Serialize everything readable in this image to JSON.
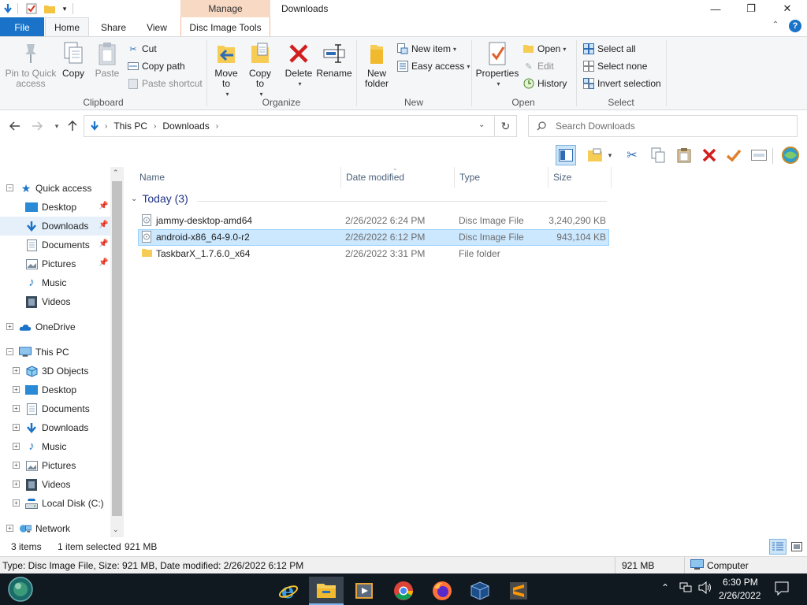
{
  "window": {
    "title": "Downloads",
    "context_tab_group": "Manage",
    "minimize": "—",
    "maximize": "❐",
    "close": "✕"
  },
  "ribbon_tabs": [
    {
      "label": "File"
    },
    {
      "label": "Home"
    },
    {
      "label": "Share"
    },
    {
      "label": "View"
    },
    {
      "label": "Disc Image Tools"
    }
  ],
  "ribbon": {
    "clipboard": {
      "label": "Clipboard",
      "pin": "Pin to Quick access",
      "copy": "Copy",
      "paste": "Paste",
      "cut": "Cut",
      "copy_path": "Copy path",
      "paste_shortcut": "Paste shortcut"
    },
    "organize": {
      "label": "Organize",
      "move_to": "Move to",
      "copy_to": "Copy to",
      "delete": "Delete",
      "rename": "Rename"
    },
    "new": {
      "label": "New",
      "new_folder": "New folder",
      "new_item": "New item",
      "easy_access": "Easy access"
    },
    "open": {
      "label": "Open",
      "properties": "Properties",
      "open": "Open",
      "edit": "Edit",
      "history": "History"
    },
    "select": {
      "label": "Select",
      "select_all": "Select all",
      "select_none": "Select none",
      "invert": "Invert selection"
    }
  },
  "address": {
    "crumbs": [
      "This PC",
      "Downloads"
    ],
    "search_placeholder": "Search Downloads"
  },
  "nav_pane": {
    "quick_access": "Quick access",
    "quick_items": [
      "Desktop",
      "Downloads",
      "Documents",
      "Pictures",
      "Music",
      "Videos"
    ],
    "onedrive": "OneDrive",
    "this_pc": "This PC",
    "pc_items": [
      "3D Objects",
      "Desktop",
      "Documents",
      "Downloads",
      "Music",
      "Pictures",
      "Videos",
      "Local Disk (C:)"
    ],
    "network": "Network"
  },
  "file_list": {
    "columns": [
      "Name",
      "Date modified",
      "Type",
      "Size"
    ],
    "group": "Today (3)",
    "rows": [
      {
        "name": "jammy-desktop-amd64",
        "date": "2/26/2022 6:24 PM",
        "type": "Disc Image File",
        "size": "3,240,290 KB"
      },
      {
        "name": "android-x86_64-9.0-r2",
        "date": "2/26/2022 6:12 PM",
        "type": "Disc Image File",
        "size": "943,104 KB"
      },
      {
        "name": "TaskbarX_1.7.6.0_x64",
        "date": "2/26/2022 3:31 PM",
        "type": "File folder",
        "size": ""
      }
    ]
  },
  "status": {
    "item_count": "3 items",
    "selected": "1 item selected",
    "selected_size": "921 MB"
  },
  "details": {
    "text": "Type: Disc Image File, Size: 921 MB, Date modified: 2/26/2022 6:12 PM",
    "size": "921 MB",
    "location": "Computer"
  },
  "taskbar": {
    "time": "6:30 PM",
    "date": "2/26/2022"
  },
  "colors": {
    "accent": "#1a73c8",
    "selection": "#cce8ff",
    "context_tab": "#f8d9c4"
  }
}
